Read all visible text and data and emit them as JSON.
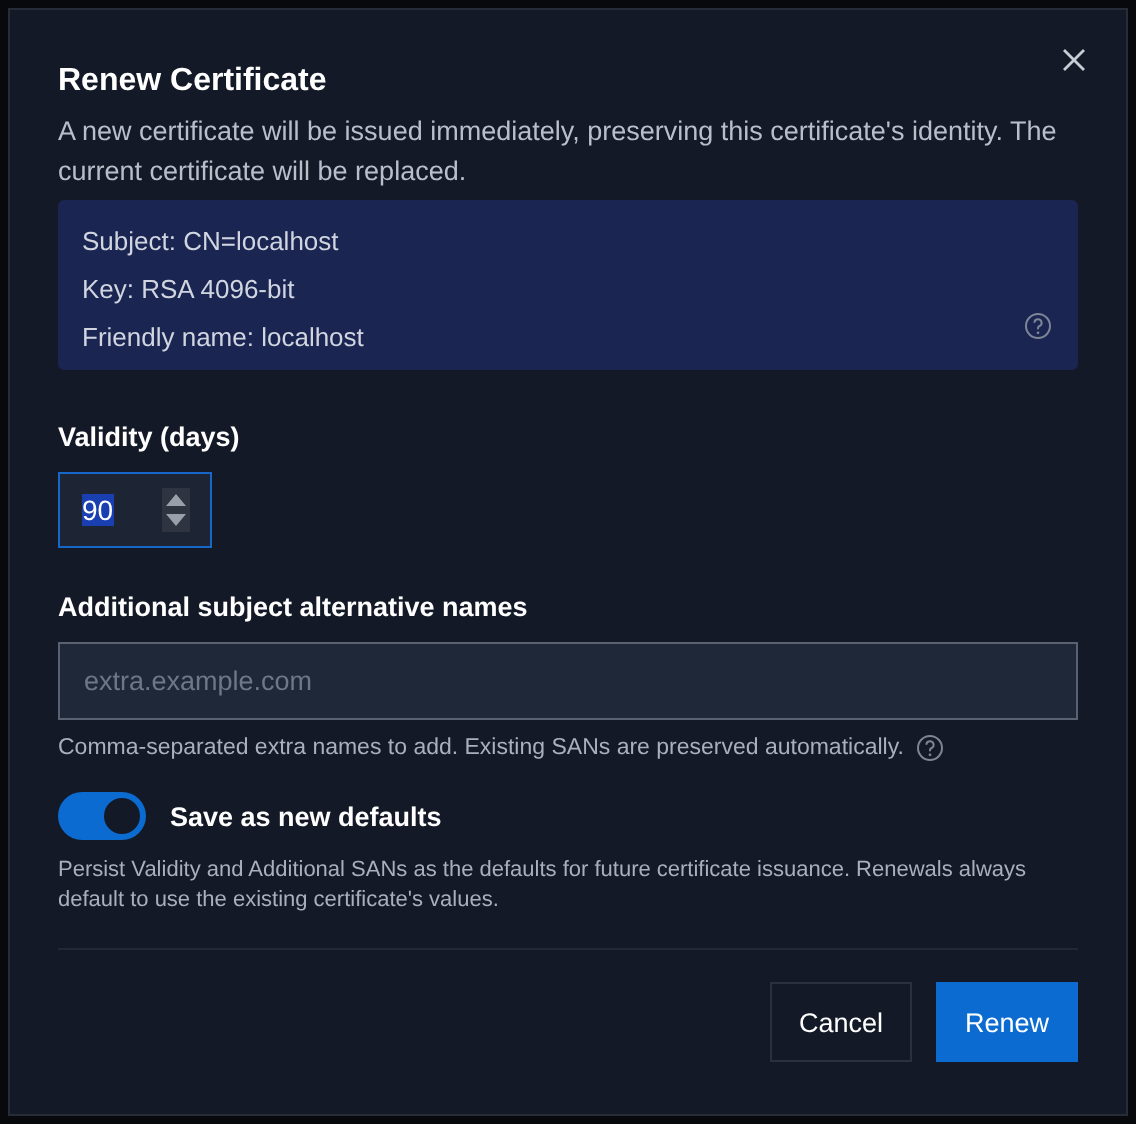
{
  "dialog": {
    "title": "Renew Certificate",
    "description": "A new certificate will be issued immediately, preserving this certificate's identity. The current certificate will be replaced.",
    "info": [
      "Subject: CN=localhost",
      "Key: RSA 4096-bit",
      "Friendly name: localhost"
    ],
    "validity": {
      "label": "Validity (days)",
      "value": "90",
      "value_selected": true
    },
    "sans": {
      "label": "Additional subject alternative names",
      "placeholder": "extra.example.com",
      "help": "Comma-separated extra names to add. Existing SANs are preserved automatically."
    },
    "save_defaults": {
      "label": "Save as new defaults",
      "on": true,
      "help": "Persist Validity and Additional SANs as the defaults for future certificate issuance. Renewals always default to use the existing certificate's values."
    },
    "buttons": [
      {
        "label": "Cancel",
        "kind": "secondary"
      },
      {
        "label": "Renew",
        "kind": "primary"
      }
    ]
  }
}
